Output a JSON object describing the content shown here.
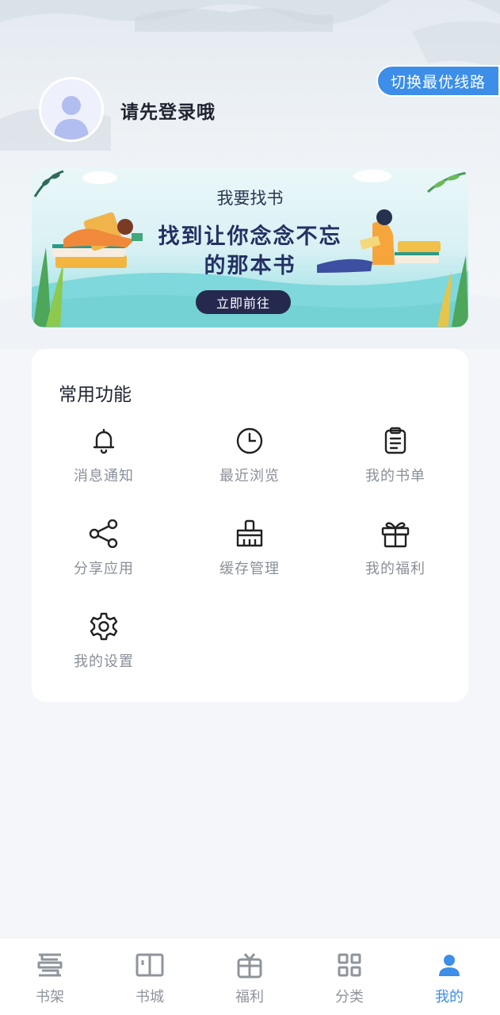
{
  "header": {
    "route_button": "切换最优线路",
    "login_prompt": "请先登录哦"
  },
  "banner": {
    "title": "我要找书",
    "headline_line1": "找到让你念念不忘",
    "headline_line2": "的那本书",
    "cta": "立即前往"
  },
  "functions": {
    "title": "常用功能",
    "items": [
      {
        "label": "消息通知",
        "icon": "bell-icon"
      },
      {
        "label": "最近浏览",
        "icon": "clock-icon"
      },
      {
        "label": "我的书单",
        "icon": "clipboard-icon"
      },
      {
        "label": "分享应用",
        "icon": "share-icon"
      },
      {
        "label": "缓存管理",
        "icon": "broom-icon"
      },
      {
        "label": "我的福利",
        "icon": "gift-icon"
      },
      {
        "label": "我的设置",
        "icon": "gear-icon"
      }
    ]
  },
  "tabbar": {
    "active": "我的",
    "accent_color": "#3c8ee8",
    "items": [
      {
        "label": "书架",
        "icon": "bookshelf-icon"
      },
      {
        "label": "书城",
        "icon": "open-book-icon"
      },
      {
        "label": "福利",
        "icon": "gift-icon"
      },
      {
        "label": "分类",
        "icon": "grid-icon"
      },
      {
        "label": "我的",
        "icon": "person-icon"
      }
    ]
  }
}
